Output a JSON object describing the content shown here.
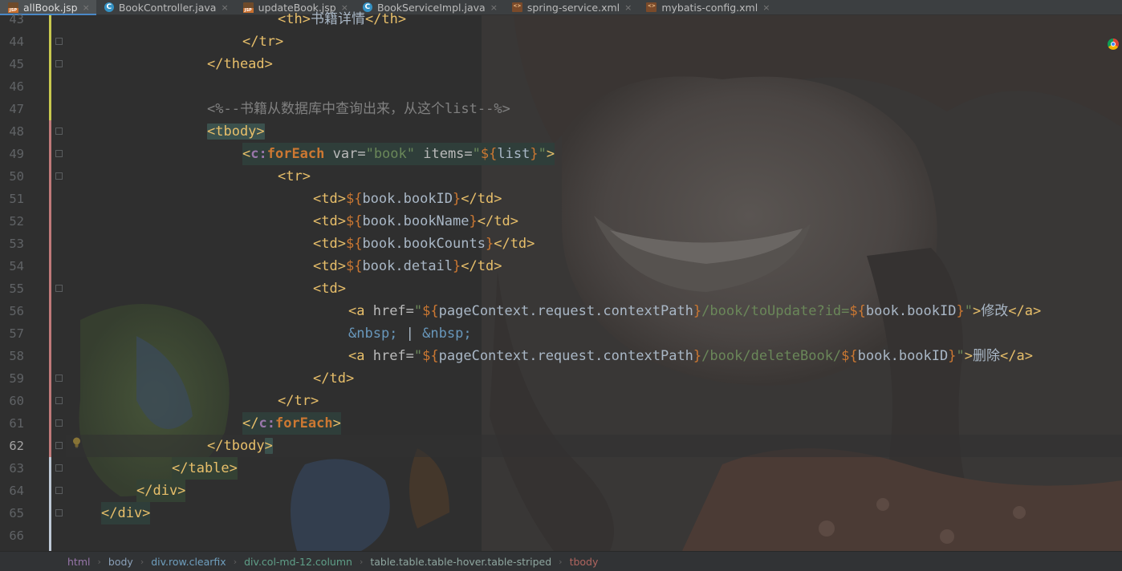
{
  "tabs": [
    {
      "label": "allBook.jsp",
      "type": "jsp",
      "active": true
    },
    {
      "label": "BookController.java",
      "type": "java",
      "active": false
    },
    {
      "label": "updateBook.jsp",
      "type": "jsp",
      "active": false
    },
    {
      "label": "BookServiceImpl.java",
      "type": "java",
      "active": false
    },
    {
      "label": "spring-service.xml",
      "type": "xml",
      "active": false
    },
    {
      "label": "mybatis-config.xml",
      "type": "xml",
      "active": false
    }
  ],
  "tab_close_glyph": "×",
  "editor": {
    "current_line": "62",
    "line_numbers": [
      "43",
      "44",
      "45",
      "46",
      "47",
      "48",
      "49",
      "50",
      "51",
      "52",
      "53",
      "54",
      "55",
      "56",
      "57",
      "58",
      "59",
      "60",
      "61",
      "62",
      "63",
      "64",
      "65",
      "66"
    ],
    "lines": {
      "l43": {
        "open": "<th>",
        "text": "书籍详情",
        "close": "</th>"
      },
      "l44": {
        "text": "</tr>"
      },
      "l45": {
        "text": "</thead>"
      },
      "l47": {
        "text": "<%--书籍从数据库中查询出来，从这个list--%>"
      },
      "l48": {
        "text": "<tbody>"
      },
      "l49": {
        "lt": "<",
        "ns": "c:",
        "name": "forEach",
        "a1": " var=",
        "v1": "\"book\"",
        "a2": " items=",
        "q1": "\"",
        "d": "${",
        "e": "list",
        "b": "}",
        "q2": "\"",
        "gt": ">"
      },
      "l50": {
        "text": "<tr>"
      },
      "l51": {
        "open": "<td>",
        "d": "${",
        "e": "book.bookID",
        "b": "}",
        "close": "</td>"
      },
      "l52": {
        "open": "<td>",
        "d": "${",
        "e": "book.bookName",
        "b": "}",
        "close": "</td>"
      },
      "l53": {
        "open": "<td>",
        "d": "${",
        "e": "book.bookCounts",
        "b": "}",
        "close": "</td>"
      },
      "l54": {
        "open": "<td>",
        "d": "${",
        "e": "book.detail",
        "b": "}",
        "close": "</td>"
      },
      "l55": {
        "text": "<td>"
      },
      "l56": {
        "open": "<a",
        "a": " href=",
        "q1": "\"",
        "d1": "${",
        "e1": "pageContext.request.contextPath",
        "b1": "}",
        "path": "/book/toUpdate?id=",
        "d2": "${",
        "e2": "book.bookID",
        "b2": "}",
        "q2": "\"",
        "gt": ">",
        "label": "修改",
        "close": "</a>"
      },
      "l57": {
        "n1": "&nbsp;",
        "sep": " | ",
        "n2": "&nbsp;"
      },
      "l58": {
        "open": "<a",
        "a": " href=",
        "q1": "\"",
        "d1": "${",
        "e1": "pageContext.request.contextPath",
        "b1": "}",
        "path": "/book/deleteBook/",
        "d2": "${",
        "e2": "book.bookID",
        "b2": "}",
        "q2": "\"",
        "gt": ">",
        "label": "删除",
        "close": "</a>"
      },
      "l59": {
        "text": "</td>"
      },
      "l60": {
        "text": "</tr>"
      },
      "l61": {
        "lt": "</",
        "ns": "c:",
        "name": "forEach",
        "gt": ">"
      },
      "l62": {
        "text": "</tbody",
        "gt": ">"
      },
      "l63": {
        "text": "</table>"
      },
      "l64": {
        "text": "</div>"
      },
      "l65": {
        "text": "</div>"
      }
    }
  },
  "breadcrumb": [
    "html",
    "body",
    "div.row.clearfix",
    "div.col-md-12.column",
    "table.table.table-hover.table-striped",
    "tbody"
  ],
  "breadcrumb_separator": "›",
  "colors": {
    "tag": "#e8bf6a",
    "string": "#6a8759",
    "keyword": "#cc7832",
    "comment": "#808080",
    "entity": "#6897bb",
    "active_tab_underline": "#4a88c7"
  }
}
